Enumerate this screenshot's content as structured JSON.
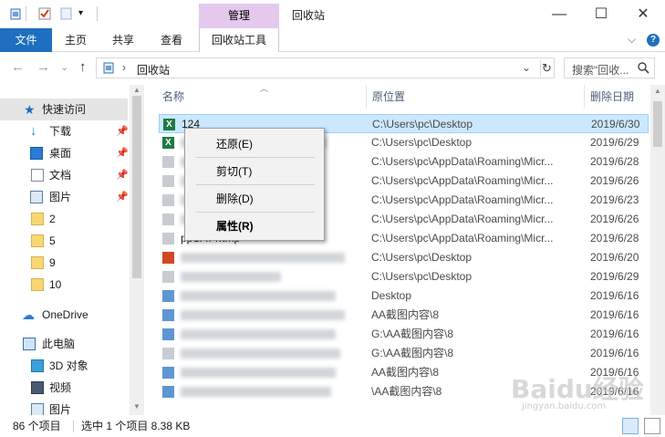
{
  "titlebar": {
    "manage_tab": "管理",
    "title": "回收站",
    "minimize": "—",
    "maximize": "☐",
    "close": "✕"
  },
  "ribbon": {
    "file": "文件",
    "home": "主页",
    "share": "共享",
    "view": "查看",
    "tools": "回收站工具",
    "help": "?",
    "collapse": "⌵"
  },
  "nav": {
    "back": "←",
    "forward": "→",
    "recent": "⌄",
    "up": "↑",
    "chevron": "›",
    "path": "回收站",
    "dropdown": "⌄",
    "refresh": "↻",
    "search_placeholder": "搜索\"回收..."
  },
  "sidebar": {
    "quick_access": "快速访问",
    "items": [
      {
        "label": "下载",
        "pinned": true
      },
      {
        "label": "桌面",
        "pinned": true
      },
      {
        "label": "文档",
        "pinned": true
      },
      {
        "label": "图片",
        "pinned": true
      },
      {
        "label": "2",
        "pinned": false
      },
      {
        "label": "5",
        "pinned": false
      },
      {
        "label": "9",
        "pinned": false
      },
      {
        "label": "10",
        "pinned": false
      }
    ],
    "onedrive": "OneDrive",
    "this_pc": "此电脑",
    "pc_items": [
      "3D 对象",
      "视频",
      "图片"
    ]
  },
  "columns": {
    "name": "名称",
    "original_location": "原位置",
    "date_deleted": "删除日期"
  },
  "rows": [
    {
      "name": "124",
      "location": "C:\\Users\\pc\\Desktop",
      "date": "2019/6/30",
      "selected": true,
      "icon": "excel"
    },
    {
      "name": "",
      "location": "C:\\Users\\pc\\Desktop",
      "date": "2019/6/29",
      "selected": false,
      "icon": "excel"
    },
    {
      "name": "",
      "location": "C:\\Users\\pc\\AppData\\Roaming\\Micr...",
      "date": "2019/6/28",
      "selected": false,
      "icon": "doc"
    },
    {
      "name": "",
      "location": "C:\\Users\\pc\\AppData\\Roaming\\Micr...",
      "date": "2019/6/26",
      "selected": false,
      "icon": "doc"
    },
    {
      "name": "",
      "location": "C:\\Users\\pc\\AppData\\Roaming\\Micr...",
      "date": "2019/6/23",
      "selected": false,
      "icon": "doc"
    },
    {
      "name": "",
      "location": "C:\\Users\\pc\\AppData\\Roaming\\Micr...",
      "date": "2019/6/26",
      "selected": false,
      "icon": "doc"
    },
    {
      "name": "ppSATT.tmp",
      "location": "C:\\Users\\pc\\AppData\\Roaming\\Micr...",
      "date": "2019/6/28",
      "selected": false,
      "icon": "doc"
    },
    {
      "name": "",
      "location": "C:\\Users\\pc\\Desktop",
      "date": "2019/6/20",
      "selected": false,
      "icon": "ppt"
    },
    {
      "name": "",
      "location": "C:\\Users\\pc\\Desktop",
      "date": "2019/6/29",
      "selected": false,
      "icon": "doc"
    },
    {
      "name": "",
      "location": "Desktop",
      "date": "2019/6/16",
      "selected": false,
      "icon": "img"
    },
    {
      "name": "",
      "location": "AA截图内容\\8",
      "date": "2019/6/16",
      "selected": false,
      "icon": "img"
    },
    {
      "name": "",
      "location": "G:\\AA截图内容\\8",
      "date": "2019/6/16",
      "selected": false,
      "icon": "img"
    },
    {
      "name": "",
      "location": "G:\\AA截图内容\\8",
      "date": "2019/6/16",
      "selected": false,
      "icon": "doc"
    },
    {
      "name": "",
      "location": "AA截图内容\\8",
      "date": "2019/6/16",
      "selected": false,
      "icon": "img"
    },
    {
      "name": "",
      "location": "\\AA截图内容\\8",
      "date": "2019/6/16",
      "selected": false,
      "icon": "img"
    }
  ],
  "context_menu": {
    "restore": "还原(E)",
    "cut": "剪切(T)",
    "delete": "删除(D)",
    "properties": "属性(R)"
  },
  "status": {
    "count": "86 个项目",
    "selection": "选中 1 个项目  8.38 KB"
  },
  "watermark": {
    "brand": "Baidu经验",
    "url": "jingyan.baidu.com"
  }
}
